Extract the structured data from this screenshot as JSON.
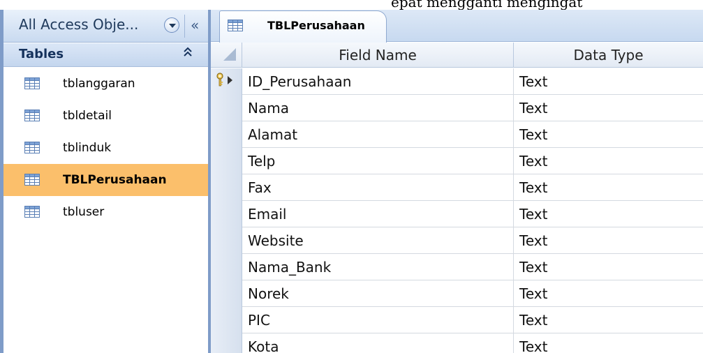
{
  "top_fragment": "epat mengganti mengingat",
  "nav": {
    "header_title": "All Access Obje...",
    "collapse_glyph": "«",
    "group_label": "Tables",
    "group_chevron": "≈",
    "items": [
      {
        "label": "tblanggaran",
        "icon": "table-icon",
        "selected": false
      },
      {
        "label": "tbldetail",
        "icon": "table-icon",
        "selected": false
      },
      {
        "label": "tblinduk",
        "icon": "table-icon",
        "selected": false
      },
      {
        "label": "TBLPerusahaan",
        "icon": "table-icon",
        "selected": true
      },
      {
        "label": "tbluser",
        "icon": "table-icon",
        "selected": false
      }
    ]
  },
  "document": {
    "tab_label": "TBLPerusahaan",
    "columns": {
      "field_name": "Field Name",
      "data_type": "Data Type"
    },
    "rows": [
      {
        "field": "ID_Perusahaan",
        "type": "Text",
        "primary_key": true,
        "current": true
      },
      {
        "field": "Nama",
        "type": "Text"
      },
      {
        "field": "Alamat",
        "type": "Text"
      },
      {
        "field": "Telp",
        "type": "Text"
      },
      {
        "field": "Fax",
        "type": "Text"
      },
      {
        "field": "Email",
        "type": "Text"
      },
      {
        "field": "Website",
        "type": "Text"
      },
      {
        "field": "Nama_Bank",
        "type": "Text"
      },
      {
        "field": "Norek",
        "type": "Text"
      },
      {
        "field": "PIC",
        "type": "Text"
      },
      {
        "field": "Kota",
        "type": "Text"
      }
    ]
  },
  "colors": {
    "selected_item": "#fbbf6b",
    "frame_border": "#7f9cc8",
    "header_text": "#1e395b"
  }
}
